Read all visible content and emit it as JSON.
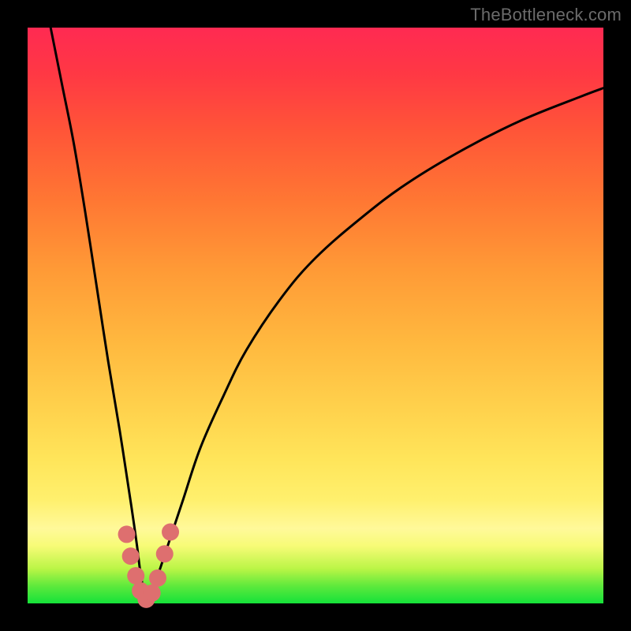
{
  "watermark": "TheBottleneck.com",
  "chart_data": {
    "type": "line",
    "title": "",
    "xlabel": "",
    "ylabel": "",
    "xlim": [
      0,
      100
    ],
    "ylim": [
      0,
      100
    ],
    "series": [
      {
        "name": "left-branch",
        "x": [
          4,
          6,
          8,
          10,
          12,
          14,
          16,
          18,
          19,
          19.5,
          20,
          20.6
        ],
        "y": [
          100,
          90,
          80,
          68,
          55,
          42,
          30,
          17,
          10,
          6,
          3,
          0.5
        ]
      },
      {
        "name": "right-branch",
        "x": [
          20.6,
          22,
          23,
          25,
          27,
          30,
          34,
          38,
          44,
          50,
          58,
          66,
          76,
          86,
          96,
          100
        ],
        "y": [
          0.5,
          3,
          6,
          12,
          18,
          27,
          36,
          44,
          53,
          60,
          67,
          73,
          79,
          84,
          88,
          89.5
        ]
      }
    ],
    "notch_markers": {
      "name": "notch-dots",
      "color": "#de6f6f",
      "points": [
        {
          "x": 17.2,
          "y": 12.0
        },
        {
          "x": 17.9,
          "y": 8.2
        },
        {
          "x": 18.8,
          "y": 4.8
        },
        {
          "x": 19.6,
          "y": 2.2
        },
        {
          "x": 20.6,
          "y": 0.7
        },
        {
          "x": 21.6,
          "y": 1.8
        },
        {
          "x": 22.6,
          "y": 4.4
        },
        {
          "x": 23.8,
          "y": 8.6
        },
        {
          "x": 24.8,
          "y": 12.4
        }
      ]
    }
  }
}
